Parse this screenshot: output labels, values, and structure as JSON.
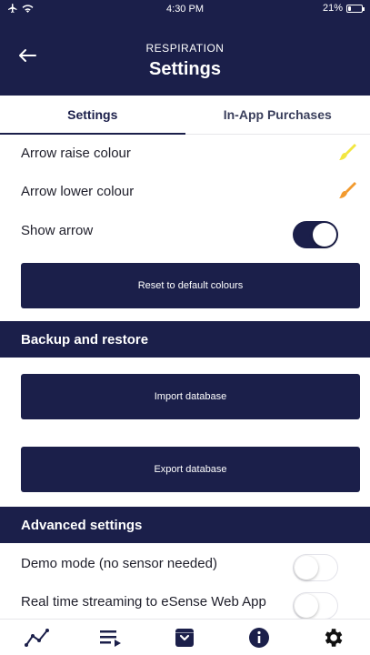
{
  "status_bar": {
    "time": "4:30 PM",
    "battery": "21%",
    "battery_level": 0.21,
    "icons": [
      "airplane-icon",
      "wifi-icon",
      "battery-icon"
    ]
  },
  "header": {
    "subtitle": "RESPIRATION",
    "title": "Settings",
    "back_icon": "arrow-left-icon"
  },
  "tabs": [
    {
      "label": "Settings",
      "active": true
    },
    {
      "label": "In-App Purchases",
      "active": false
    }
  ],
  "display_settings": {
    "arrow_raise": {
      "label": "Arrow raise colour",
      "color": "#f2e640"
    },
    "arrow_lower": {
      "label": "Arrow lower colour",
      "color": "#f29a2e"
    },
    "show_arrow": {
      "label": "Show arrow",
      "enabled": true
    },
    "reset_button": "Reset to default colours"
  },
  "backup": {
    "title": "Backup and restore",
    "import_button": "Import database",
    "export_button": "Export database"
  },
  "advanced": {
    "title": "Advanced settings",
    "demo_mode": {
      "label": "Demo mode (no sensor needed)",
      "enabled": false
    },
    "streaming": {
      "label": "Real time streaming to eSense Web App",
      "enabled": false
    }
  },
  "bottom_nav": [
    {
      "name": "graph-icon",
      "active": false
    },
    {
      "name": "playlist-icon",
      "active": false
    },
    {
      "name": "archive-icon",
      "active": false
    },
    {
      "name": "info-icon",
      "active": false
    },
    {
      "name": "settings-icon",
      "active": true
    }
  ],
  "colors": {
    "primary": "#1b1f4a",
    "toggle_on": "#1b1f4a"
  }
}
